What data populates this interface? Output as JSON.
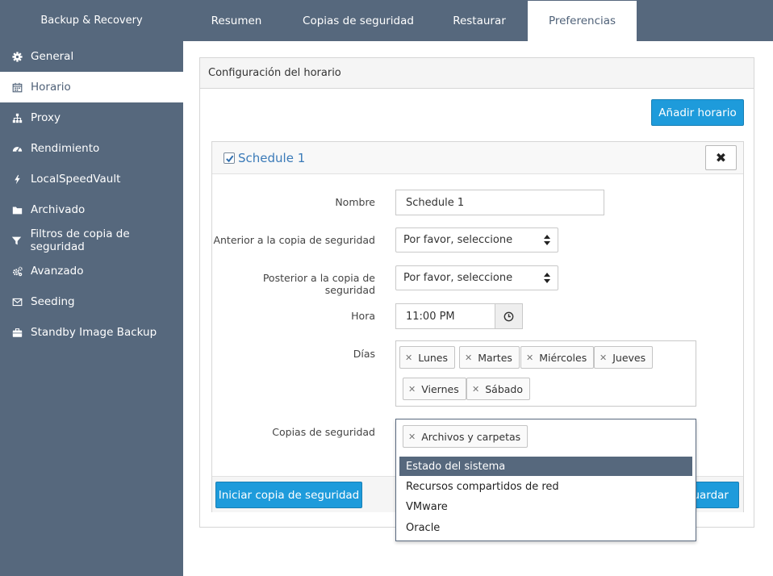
{
  "app": {
    "brand": "Backup & Recovery"
  },
  "tabs": [
    {
      "label": "Resumen"
    },
    {
      "label": "Copias de seguridad"
    },
    {
      "label": "Restaurar"
    },
    {
      "label": "Preferencias"
    }
  ],
  "sidebar": {
    "items": [
      {
        "label": "General",
        "icon": "gear-icon"
      },
      {
        "label": "Horario",
        "icon": "calendar-icon"
      },
      {
        "label": "Proxy",
        "icon": "sitemap-icon"
      },
      {
        "label": "Rendimiento",
        "icon": "dashboard-icon"
      },
      {
        "label": "LocalSpeedVault",
        "icon": "bolt-icon"
      },
      {
        "label": "Archivado",
        "icon": "folder-icon"
      },
      {
        "label": "Filtros de copia de seguridad",
        "icon": "filter-icon"
      },
      {
        "label": "Avanzado",
        "icon": "cogs-icon"
      },
      {
        "label": "Seeding",
        "icon": "envelope-icon"
      },
      {
        "label": "Standby Image Backup",
        "icon": "briefcase-icon"
      }
    ]
  },
  "panel": {
    "title": "Configuración del horario",
    "add_button": "Añadir horario"
  },
  "schedule": {
    "title": "Schedule 1",
    "enabled": true,
    "name_label": "Nombre",
    "name_value": "Schedule 1",
    "before_label": "Anterior a la copia de seguridad",
    "before_value": "Por favor, seleccione",
    "after_label": "Posterior a la copia de seguridad",
    "after_value": "Por favor, seleccione",
    "time_label": "Hora",
    "time_value": "11:00 PM",
    "days_label": "Días",
    "days": [
      "Lunes",
      "Martes",
      "Miércoles",
      "Jueves",
      "Viernes",
      "Sábado"
    ],
    "backups_label": "Copias de seguridad",
    "backups_selected": [
      "Archivos y carpetas"
    ],
    "start_button": "Iniciar copia de seguridad",
    "save_button": "uardar"
  },
  "dropdown": {
    "options": [
      "Estado del sistema",
      "Recursos compartidos de red",
      "VMware",
      "Oracle"
    ],
    "highlighted": "Estado del sistema"
  },
  "colors": {
    "sidebar_bg": "#56687d",
    "accent_blue": "#1e9bdb",
    "link_blue": "#3a7ab8"
  }
}
